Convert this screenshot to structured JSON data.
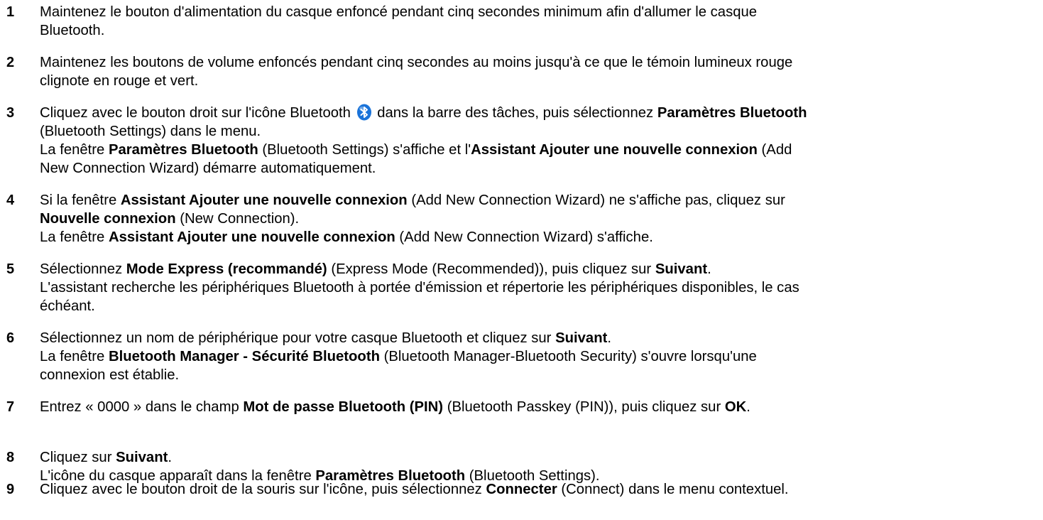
{
  "steps": [
    {
      "number": "1",
      "lines": [
        [
          {
            "t": "Maintenez le bouton d'alimentation du casque enfoncé pendant cinq secondes minimum afin d'allumer le casque"
          }
        ],
        [
          {
            "t": "Bluetooth."
          }
        ]
      ]
    },
    {
      "number": "2",
      "lines": [
        [
          {
            "t": "Maintenez les boutons de volume enfoncés pendant cinq secondes au moins jusqu'à ce que le témoin lumineux rouge"
          }
        ],
        [
          {
            "t": "clignote en rouge et vert."
          }
        ]
      ]
    },
    {
      "number": "3",
      "lines": [
        [
          {
            "t": "Cliquez avec le bouton droit sur l'icône Bluetooth "
          },
          {
            "icon": "bluetooth-icon"
          },
          {
            "t": " dans la barre des tâches, puis sélectionnez "
          },
          {
            "t": "Paramètres Bluetooth",
            "b": true
          }
        ],
        [
          {
            "t": "(Bluetooth Settings) dans le menu."
          }
        ],
        [
          {
            "t": "La fenêtre "
          },
          {
            "t": "Paramètres Bluetooth",
            "b": true
          },
          {
            "t": " (Bluetooth Settings) s'affiche et l'"
          },
          {
            "t": "Assistant Ajouter une nouvelle connexion",
            "b": true
          },
          {
            "t": " (Add"
          }
        ],
        [
          {
            "t": "New Connection Wizard) démarre automatiquement."
          }
        ]
      ]
    },
    {
      "number": "4",
      "lines": [
        [
          {
            "t": "Si la fenêtre "
          },
          {
            "t": "Assistant Ajouter une nouvelle connexion",
            "b": true
          },
          {
            "t": " (Add New Connection Wizard) ne s'affiche pas, cliquez sur"
          }
        ],
        [
          {
            "t": "Nouvelle connexion",
            "b": true
          },
          {
            "t": " (New Connection)."
          }
        ],
        [
          {
            "t": "La fenêtre "
          },
          {
            "t": "Assistant Ajouter une nouvelle connexion",
            "b": true
          },
          {
            "t": " (Add New Connection Wizard) s'affiche."
          }
        ]
      ]
    },
    {
      "number": "5",
      "lines": [
        [
          {
            "t": "Sélectionnez "
          },
          {
            "t": "Mode Express (recommandé)",
            "b": true
          },
          {
            "t": " (Express Mode (Recommended)), puis cliquez sur "
          },
          {
            "t": "Suivant",
            "b": true
          },
          {
            "t": "."
          }
        ],
        [
          {
            "t": "L'assistant recherche les périphériques Bluetooth à portée d'émission et répertorie les périphériques disponibles, le cas"
          }
        ],
        [
          {
            "t": "échéant."
          }
        ]
      ]
    },
    {
      "number": "6",
      "lines": [
        [
          {
            "t": "Sélectionnez un nom de périphérique pour votre casque Bluetooth et cliquez sur "
          },
          {
            "t": "Suivant",
            "b": true
          },
          {
            "t": "."
          }
        ],
        [
          {
            "t": "La fenêtre "
          },
          {
            "t": "Bluetooth Manager - Sécurité Bluetooth",
            "b": true
          },
          {
            "t": " (Bluetooth Manager-Bluetooth Security) s'ouvre lorsqu'une"
          }
        ],
        [
          {
            "t": "connexion est établie."
          }
        ]
      ]
    },
    {
      "number": "7",
      "lines": [
        [
          {
            "t": "Entrez « 0000 » dans le champ "
          },
          {
            "t": "Mot de passe Bluetooth (PIN)",
            "b": true
          },
          {
            "t": " (Bluetooth Passkey (PIN)), puis cliquez sur "
          },
          {
            "t": "OK",
            "b": true
          },
          {
            "t": "."
          }
        ]
      ]
    },
    {
      "number": "8",
      "lines": [
        [
          {
            "t": "Cliquez sur "
          },
          {
            "t": "Suivant",
            "b": true
          },
          {
            "t": "."
          }
        ],
        [
          {
            "t": "L'icône du casque apparaît dans la fenêtre "
          },
          {
            "t": "Paramètres Bluetooth",
            "b": true
          },
          {
            "t": " (Bluetooth Settings)."
          }
        ]
      ]
    },
    {
      "number": "9",
      "lines": [
        [
          {
            "t": "Cliquez avec le bouton droit de la souris sur l'icône, puis sélectionnez "
          },
          {
            "t": "Connecter",
            "b": true
          },
          {
            "t": " (Connect) dans le menu contextuel."
          }
        ]
      ]
    }
  ],
  "colors": {
    "text": "#000000",
    "bluetooth_icon": "#1a73d9"
  }
}
